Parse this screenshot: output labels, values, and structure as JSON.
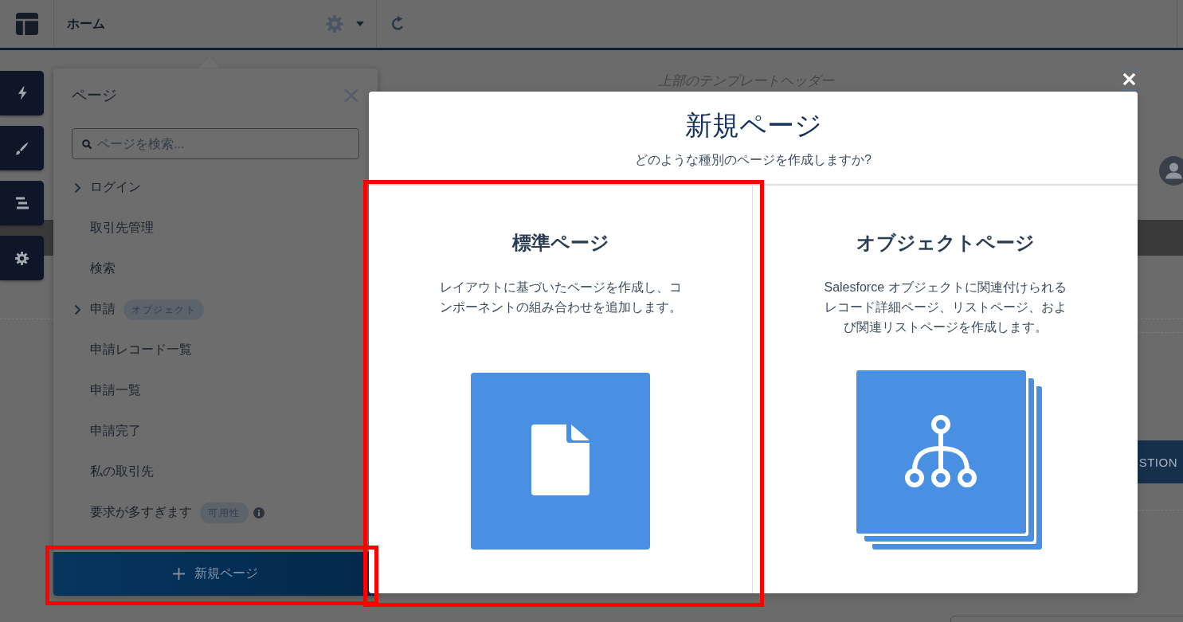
{
  "toolbar": {
    "page_name": "ホーム"
  },
  "page_canvas": {
    "template_header": "上部のテンプレートヘッダー",
    "button_label": "STION"
  },
  "pages_panel": {
    "title": "ページ",
    "search": {
      "placeholder": "ページを検索..."
    },
    "items": [
      {
        "label": "ログイン",
        "expandable": true,
        "info": false
      },
      {
        "label": "取引先管理",
        "expandable": false,
        "info": false
      },
      {
        "label": "検索",
        "expandable": false,
        "info": false
      },
      {
        "label": "申請",
        "expandable": true,
        "badge": "オブジェクト",
        "info": false
      },
      {
        "label": "申請レコード一覧",
        "expandable": false,
        "info": false
      },
      {
        "label": "申請一覧",
        "expandable": false,
        "info": false
      },
      {
        "label": "申請完了",
        "expandable": false,
        "info": false
      },
      {
        "label": "私の取引先",
        "expandable": false,
        "info": false
      },
      {
        "label": "要求が多すぎます",
        "expandable": false,
        "badge": "可用性",
        "info": true
      }
    ],
    "new_button": {
      "label": "新規ページ",
      "highlighted": true
    }
  },
  "modal": {
    "title": "新規ページ",
    "subtitle": "どのような種別のページを作成しますか?",
    "options": [
      {
        "kind": "standard",
        "title": "標準ページ",
        "description": "レイアウトに基づいたページを作成し、コンポーネントの組み合わせを追加します。",
        "highlighted": true
      },
      {
        "kind": "object",
        "title": "オブジェクトページ",
        "description": "Salesforce オブジェクトに関連付けられるレコード詳細ページ、リストページ、および関連リストページを作成します。",
        "highlighted": false
      }
    ]
  }
}
